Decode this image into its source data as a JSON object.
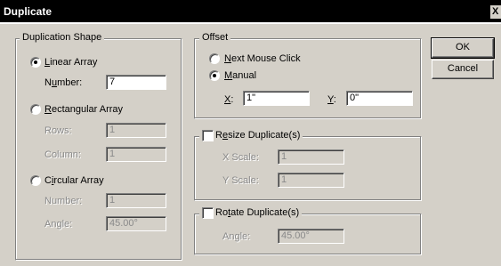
{
  "window": {
    "title": "Duplicate",
    "close_glyph": "X"
  },
  "shape_group": {
    "legend": "Duplication Shape",
    "linear": {
      "label_pre": "",
      "label_key": "L",
      "label_post": "inear Array",
      "selected": true
    },
    "linear_number": {
      "label_pre": "N",
      "label_key": "u",
      "label_post": "mber:",
      "value": "7"
    },
    "rect": {
      "label_pre": "",
      "label_key": "R",
      "label_post": "ectangular Array",
      "selected": false
    },
    "rows": {
      "label": "Rows:",
      "value": "1"
    },
    "column": {
      "label": "Column:",
      "value": "1"
    },
    "circular": {
      "label_pre": "C",
      "label_key": "i",
      "label_post": "rcular Array",
      "selected": false
    },
    "circ_number": {
      "label": "Number:",
      "value": "1"
    },
    "angle": {
      "label": "Angle:",
      "value": "45.00°"
    }
  },
  "offset_group": {
    "legend": "Offset",
    "next_mouse": {
      "label_pre": "",
      "label_key": "N",
      "label_post": "ext Mouse Click",
      "selected": false
    },
    "manual": {
      "label_pre": "",
      "label_key": "M",
      "label_post": "anual",
      "selected": true
    },
    "x": {
      "label_key": "X",
      "label_post": ":",
      "value": "1\""
    },
    "y": {
      "label_key": "Y",
      "label_post": ":",
      "value": "0\""
    }
  },
  "resize_group": {
    "legend_pre": "R",
    "legend_key": "e",
    "legend_post": "size Duplicate(s)",
    "checked": false,
    "xscale": {
      "label": "X Scale:",
      "value": "1"
    },
    "yscale": {
      "label": "Y Scale:",
      "value": "1"
    }
  },
  "rotate_group": {
    "legend_pre": "Ro",
    "legend_key": "t",
    "legend_post": "ate Duplicate(s)",
    "checked": false,
    "angle": {
      "label": "Angle:",
      "value": "45.00°"
    }
  },
  "buttons": {
    "ok": "OK",
    "cancel": "Cancel"
  }
}
